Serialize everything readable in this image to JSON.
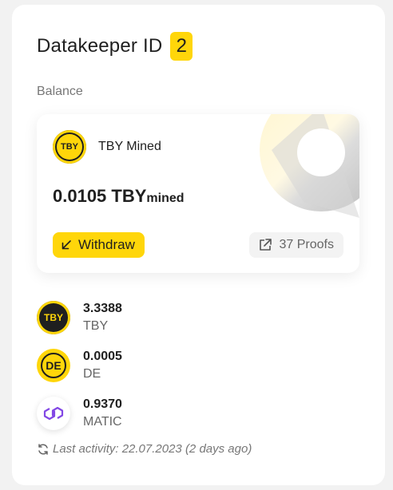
{
  "header": {
    "title": "Datakeeper ID",
    "id_number": "2"
  },
  "balance": {
    "label": "Balance",
    "mined": {
      "coin_icon": "tby-coin-icon",
      "coin_text": "TBY",
      "name": "TBY Mined",
      "amount": "0.0105 TBY",
      "unit": "mined",
      "withdraw_label": "Withdraw",
      "proofs_label": "37 Proofs"
    }
  },
  "tokens": [
    {
      "icon": "tby-coin-icon",
      "icon_text": "TBY",
      "amount": "3.3388",
      "symbol": "TBY"
    },
    {
      "icon": "de-coin-icon",
      "icon_text": "DE",
      "amount": "0.0005",
      "symbol": "DE"
    },
    {
      "icon": "matic-coin-icon",
      "icon_text": "",
      "amount": "0.9370",
      "symbol": "MATIC"
    }
  ],
  "activity": {
    "text": "Last activity: 22.07.2023 (2 days ago)"
  },
  "colors": {
    "accent": "#ffd60a",
    "text": "#1f1f1f",
    "muted": "#777777",
    "matic": "#8247e5"
  }
}
